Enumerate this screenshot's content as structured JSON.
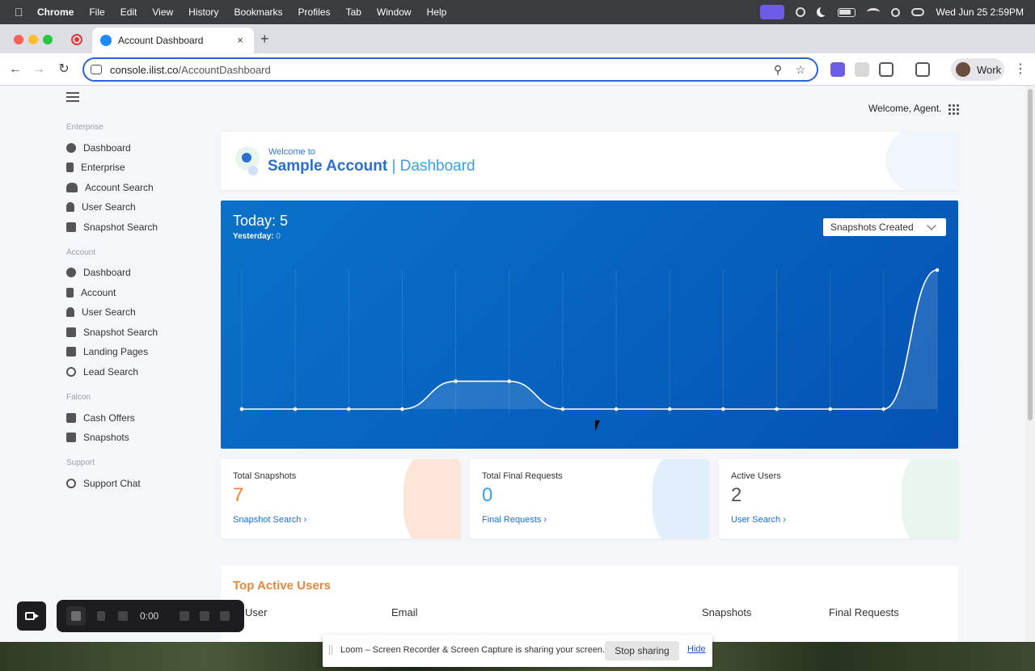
{
  "menubar": {
    "app": "Chrome",
    "items": [
      "File",
      "Edit",
      "View",
      "History",
      "Bookmarks",
      "Profiles",
      "Tab",
      "Window",
      "Help"
    ],
    "clock": "Wed Jun 25  2:59PM"
  },
  "browser": {
    "tab_title": "Account Dashboard",
    "url_host": "console.ilist.co",
    "url_path": "/AccountDashboard",
    "profile_label": "Work",
    "new_tab": "+",
    "tab_close": "×"
  },
  "header": {
    "welcome_user": "Welcome, Agent.",
    "welcome_to": "Welcome to",
    "account_name": "Sample Account",
    "separator": "|",
    "page_name": "Dashboard"
  },
  "sidebar": {
    "sections": [
      {
        "title": "Enterprise",
        "items": [
          "Dashboard",
          "Enterprise",
          "Account Search",
          "User Search",
          "Snapshot Search"
        ]
      },
      {
        "title": "Account",
        "items": [
          "Dashboard",
          "Account",
          "User Search",
          "Snapshot Search",
          "Landing Pages",
          "Lead Search"
        ]
      },
      {
        "title": "Falcon",
        "items": [
          "Cash Offers",
          "Snapshots"
        ]
      },
      {
        "title": "Support",
        "items": [
          "Support Chat"
        ]
      }
    ]
  },
  "chart_card": {
    "today_label": "Today: 5",
    "yesterday_label": "Yesterday:",
    "yesterday_value": "0",
    "metric_select": "Snapshots Created"
  },
  "chart_data": {
    "type": "line",
    "title": "",
    "series": [
      {
        "values": [
          0,
          0,
          0,
          0,
          1,
          1,
          0,
          0,
          0,
          0,
          0,
          0,
          0,
          5
        ]
      }
    ],
    "ylim": [
      0,
      5
    ],
    "grid": true,
    "line_color": "#ffffff",
    "background": "#0660bd"
  },
  "stats": [
    {
      "label": "Total Snapshots",
      "value": "7",
      "link": "Snapshot Search ›",
      "value_color": "#e8873a",
      "deco": "#f7b48a"
    },
    {
      "label": "Total Final Requests",
      "value": "0",
      "link": "Final Requests ›",
      "value_color": "#3aa0e8",
      "deco": "#a9cdf5"
    },
    {
      "label": "Active Users",
      "value": "2",
      "link": "User Search ›",
      "value_color": "#555555",
      "deco": "#bfe6cf"
    }
  ],
  "top_users": {
    "title": "Top Active Users",
    "columns": [
      "User",
      "Email",
      "Snapshots",
      "Final Requests"
    ]
  },
  "loom": {
    "timer": "0:00",
    "share_text": "Loom – Screen Recorder & Screen Capture is sharing your screen.",
    "stop_label": "Stop sharing",
    "hide_label": "Hide"
  }
}
